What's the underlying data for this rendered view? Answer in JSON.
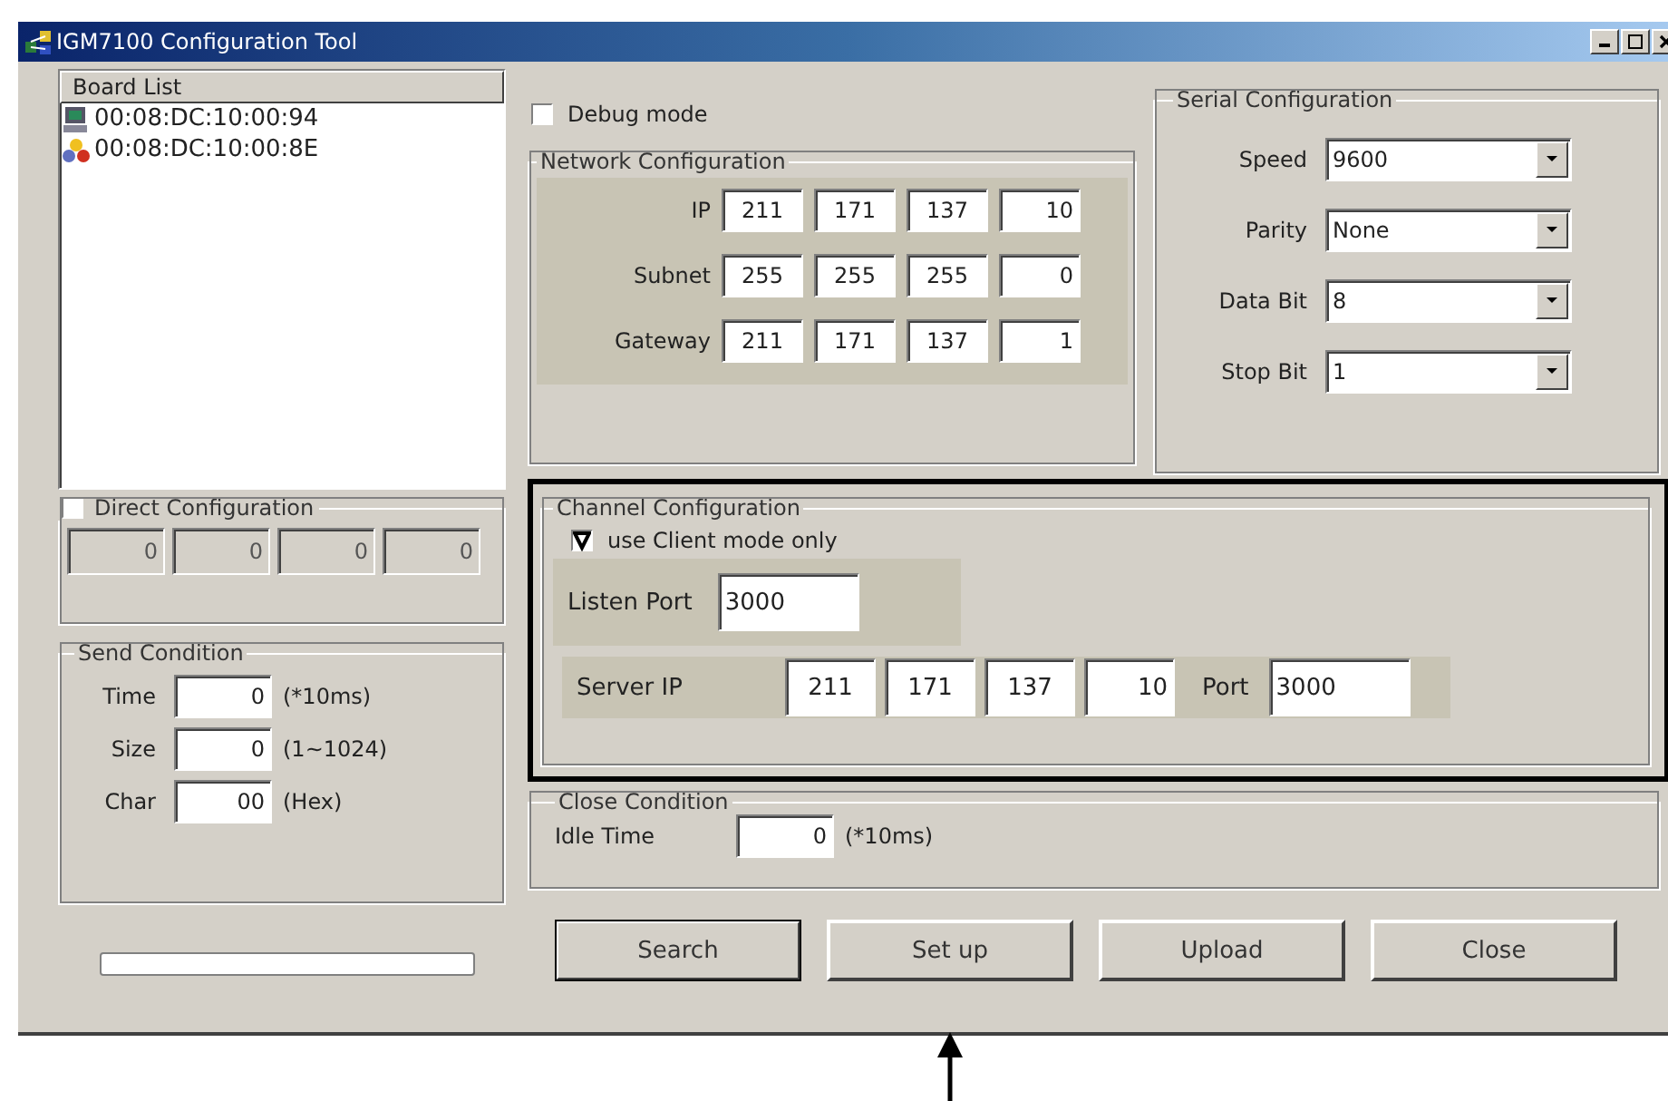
{
  "window": {
    "title": "IGM7100 Configuration Tool"
  },
  "board_list": {
    "header": "Board List",
    "items": [
      {
        "text": "00:08:DC:10:00:94",
        "kind": "computer",
        "selected": false
      },
      {
        "text": "00:08:DC:10:00:8E",
        "kind": "group",
        "selected": false
      }
    ]
  },
  "direct_configuration": {
    "label": "Direct Configuration",
    "checked": false,
    "disabled": true,
    "fields": [
      "0",
      "0",
      "0",
      "0"
    ]
  },
  "send_condition": {
    "title": "Send Condition",
    "rows": [
      {
        "label": "Time",
        "value": "0",
        "unit": "(*10ms)"
      },
      {
        "label": "Size",
        "value": "0",
        "unit": "(1~1024)"
      },
      {
        "label": "Char",
        "value": "00",
        "unit": "(Hex)"
      }
    ]
  },
  "progress": {
    "level": 0
  },
  "debug_mode": {
    "label": "Debug mode",
    "checked": false
  },
  "network_configuration": {
    "title": "Network Configuration",
    "rows": [
      {
        "label": "IP",
        "fields": [
          "211",
          "171",
          "137",
          "10"
        ]
      },
      {
        "label": "Subnet",
        "fields": [
          "255",
          "255",
          "255",
          "0"
        ]
      },
      {
        "label": "Gateway",
        "fields": [
          "211",
          "171",
          "137",
          "1"
        ]
      }
    ]
  },
  "serial_configuration": {
    "title": "Serial Configuration",
    "rows": [
      {
        "label": "Speed",
        "value": "9600"
      },
      {
        "label": "Parity",
        "value": "None"
      },
      {
        "label": "Data Bit",
        "value": "8"
      },
      {
        "label": "Stop Bit",
        "value": "1"
      }
    ]
  },
  "channel_configuration": {
    "title": "Channel Configuration",
    "highlighted": true,
    "client_mode": {
      "label": "use Client mode only",
      "checked": true
    },
    "listen_port": {
      "label": "Listen Port",
      "value": "3000"
    },
    "server": {
      "label": "Server IP",
      "fields": [
        "211",
        "171",
        "137",
        "10"
      ],
      "port_label": "Port",
      "port_value": "3000"
    }
  },
  "close_condition": {
    "title": "Close Condition",
    "label": "Idle Time",
    "value": "0",
    "unit": "(*10ms)"
  },
  "buttons": [
    {
      "label": "Search",
      "default": true
    },
    {
      "label": "Set up",
      "default": false
    },
    {
      "label": "Upload",
      "default": false
    },
    {
      "label": "Close",
      "default": false
    }
  ]
}
